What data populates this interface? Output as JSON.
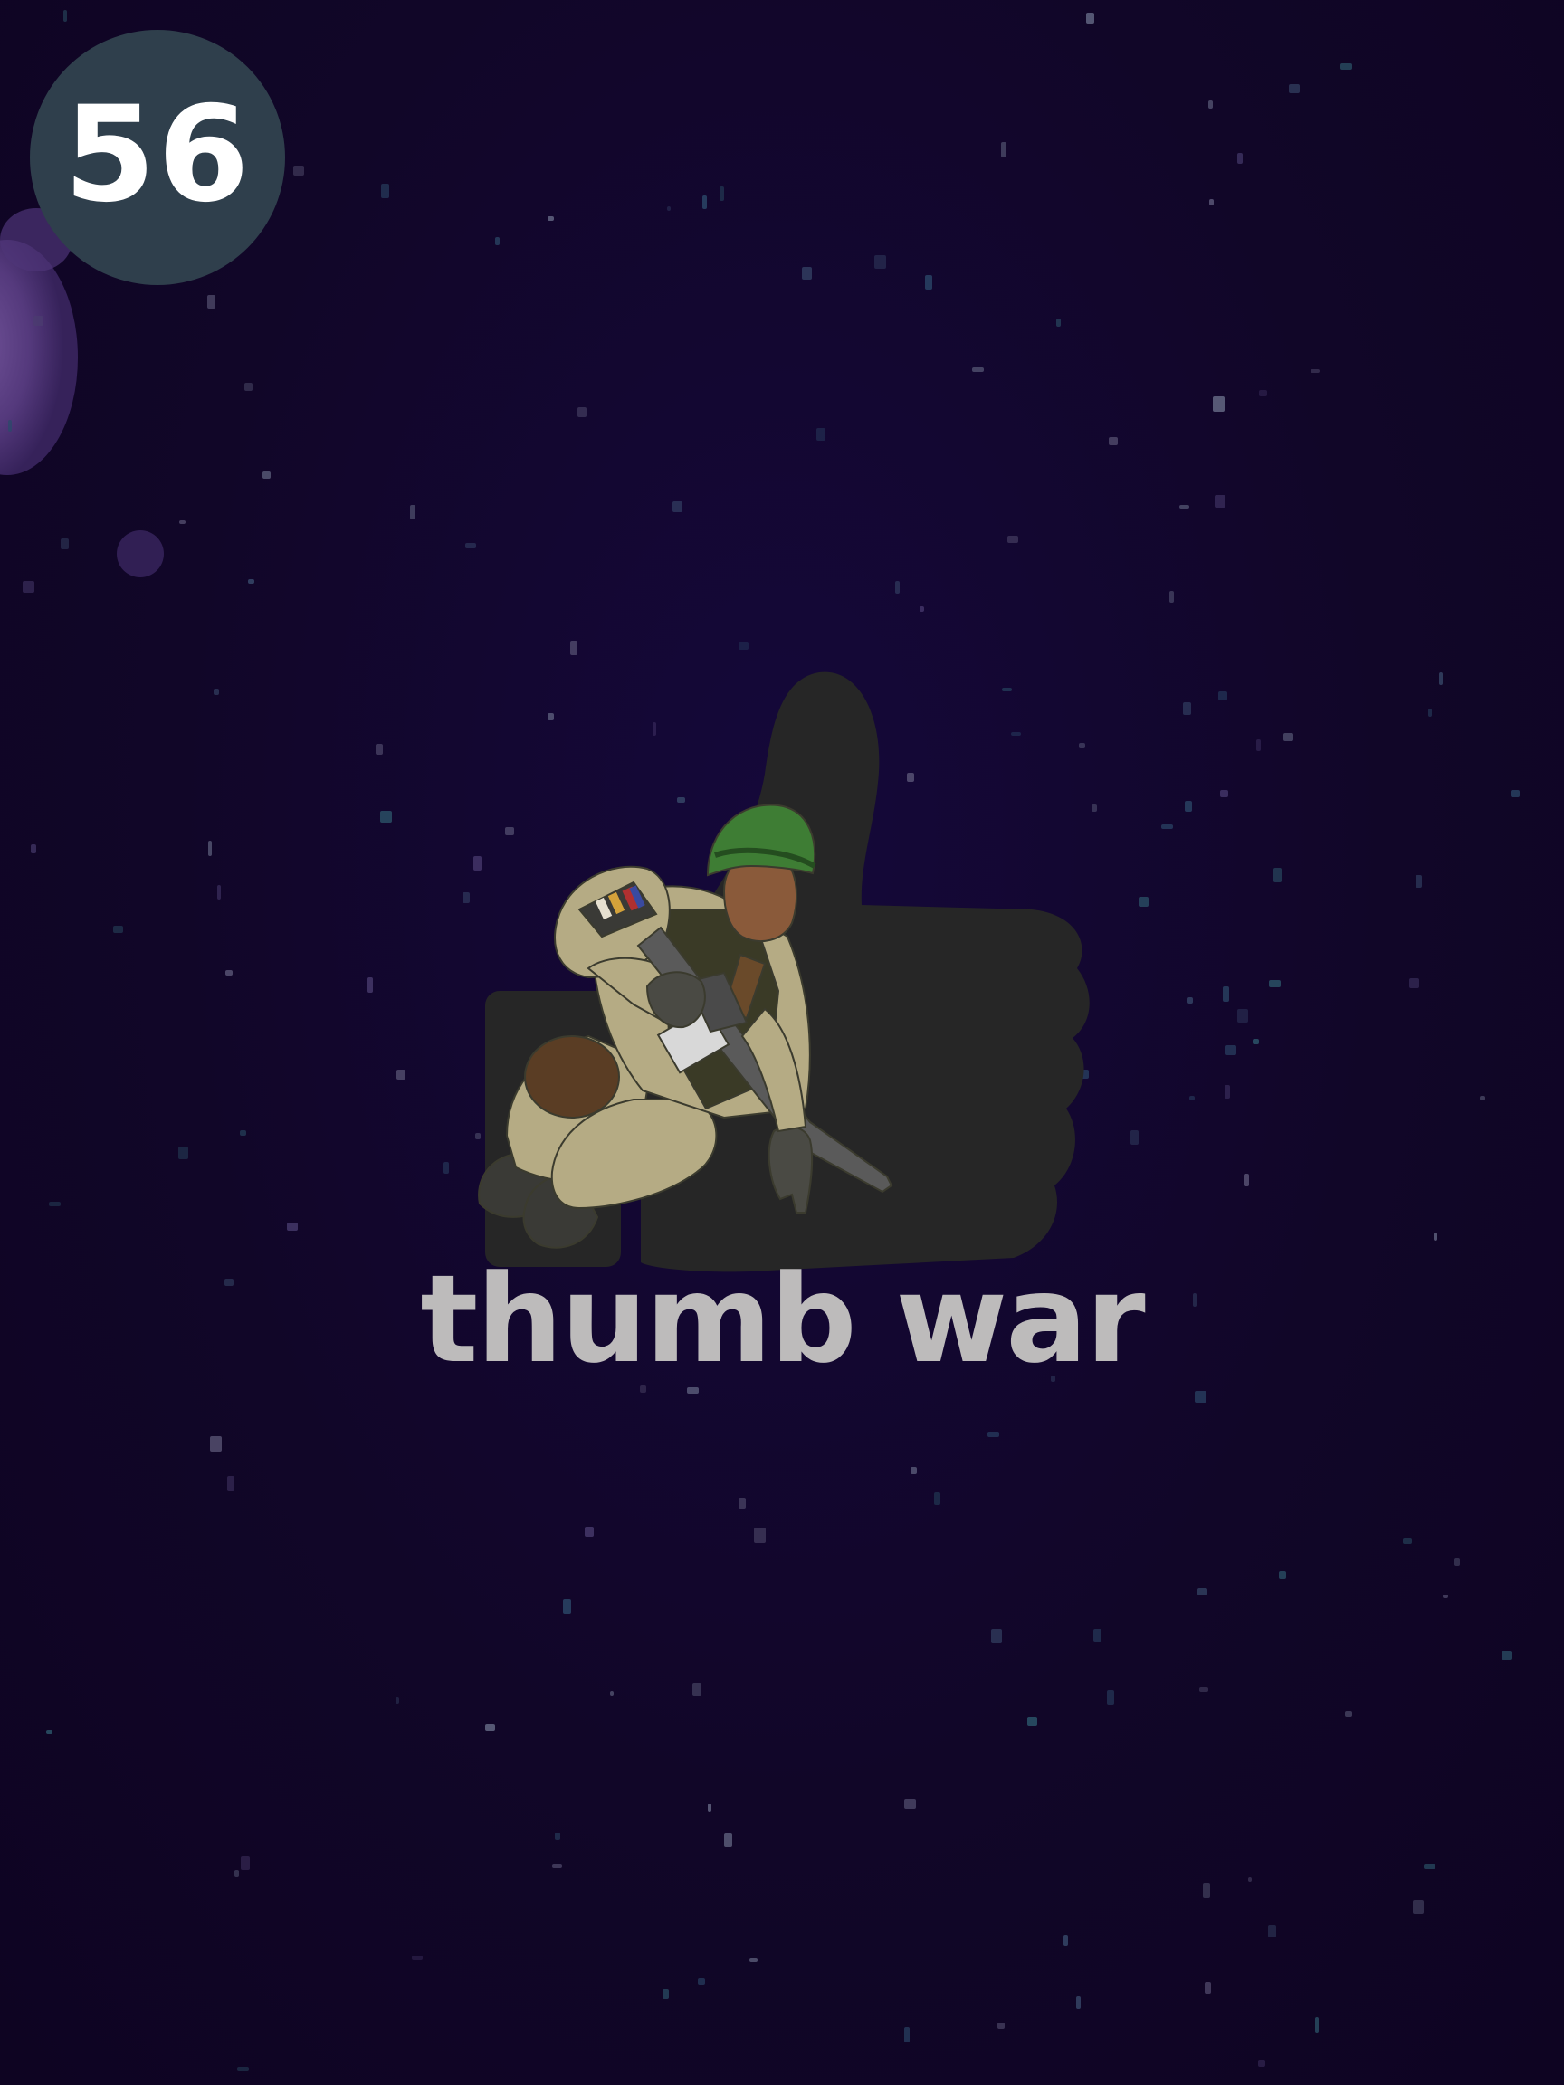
{
  "game": {
    "score": "56",
    "title": "thumb war"
  },
  "icons": {
    "hero": "thumbs-up-soldier-icon",
    "badge": "score-badge"
  },
  "colors": {
    "background": "#12062a",
    "badge": "#2f3f4c",
    "score_text": "#ffffff",
    "title_text": "#bdbbbb",
    "thumb": "#262626",
    "helmet": "#3e7d34",
    "uniform": "#b5ab84"
  }
}
